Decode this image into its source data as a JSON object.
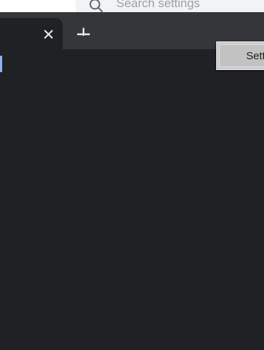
{
  "settings": {
    "search_placeholder": "Search settings"
  },
  "tabstrip": {
    "tab_close_icon": "close-icon",
    "new_tab_icon": "plus-icon"
  },
  "popup": {
    "label": "Sett"
  },
  "colors": {
    "page_background": "#202124",
    "tabstrip_background": "#35363a",
    "focus_accent": "#8ab4f8"
  }
}
